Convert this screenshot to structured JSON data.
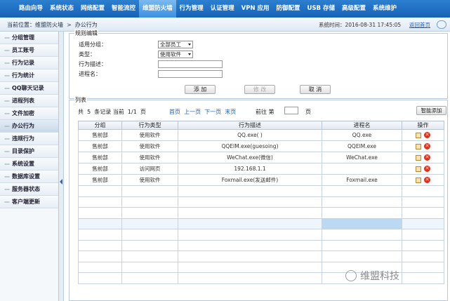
{
  "nav": {
    "items": [
      "路由向导",
      "系统状态",
      "网络配置",
      "智能流控",
      "维盟防火墙",
      "行为管理",
      "认证管理",
      "VPN 应用",
      "防御配置",
      "USB 存储",
      "高级配置",
      "系统维护"
    ],
    "active_index": 4
  },
  "subbar": {
    "location": "当前位置：维盟防火墙",
    "page": "办公行为",
    "time_label": "系统时间：",
    "time_value": "2016-08-31  17:45:05",
    "home_link": "返回首页"
  },
  "sidebar": {
    "items": [
      "分组管理",
      "员工账号",
      "行为记录",
      "行为统计",
      "QQ聊天记录",
      "进程列表",
      "文件加密",
      "办公行为",
      "违规行为",
      "目录保护",
      "系统设置",
      "数据库设置",
      "服务器状态",
      "客户端更新"
    ],
    "active_index": 7
  },
  "rule_form": {
    "legend": "规则编辑",
    "group_label": "适用分组：",
    "group_value": "全部员工",
    "type_label": "类型：",
    "type_value": "使用软件",
    "desc_label": "行为描述：",
    "desc_value": "",
    "process_label": "进程名：",
    "process_value": "",
    "add_button": "添 加",
    "modify_button": "修 改",
    "cancel_button": "取 消"
  },
  "list": {
    "legend": "列表",
    "total_prefix": "共",
    "total_count": "5",
    "total_suffix": "条记录",
    "current_label": "当前",
    "current_page": "1/1",
    "page_unit": "页",
    "first": "首页",
    "prev": "上一页",
    "next": "下一页",
    "last": "末页",
    "goto_label": "前往 第",
    "goto_suffix": "页",
    "smart_add": "智能添加",
    "columns": [
      "分组",
      "行为类型",
      "行为描述",
      "进程名",
      "操作"
    ],
    "rows": [
      [
        "售前部",
        "使用软件",
        "QQ.exe( )",
        "QQ.exe"
      ],
      [
        "售前部",
        "使用软件",
        "QQEIM.exe(guesoing)",
        "QQEIM.exe"
      ],
      [
        "售前部",
        "使用软件",
        "WeChat.exe(微信)",
        "WeChat.exe"
      ],
      [
        "售前部",
        "访问网页",
        "192.168.1.1",
        ""
      ],
      [
        "售前部",
        "使用软件",
        "Foxmail.exe(发送邮件)",
        "Foxmail.exe"
      ]
    ]
  },
  "watermark": "维盟科技"
}
